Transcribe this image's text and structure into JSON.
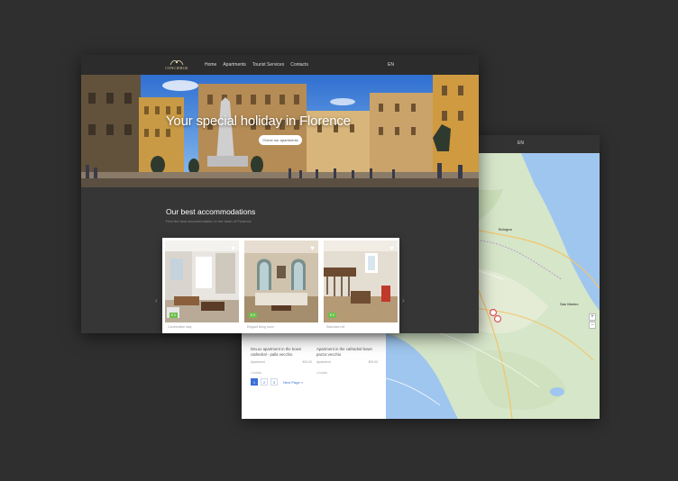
{
  "listing_window": {
    "lang": "EN",
    "cards": [
      {
        "title": "DeLux apartment in the bown cathedral - palla vecchio",
        "type": "Apartment",
        "price": "€00.00",
        "extra": "4 Adults"
      },
      {
        "title": "Apartment in the cathedral bown pazza vecchio",
        "type": "Apartment",
        "price": "€00.00",
        "extra": "4 Adults"
      }
    ],
    "pagination": {
      "pages": [
        "1",
        "2",
        "3"
      ],
      "next_label": "Next Page »"
    },
    "map": {
      "labels": {
        "city_a": "Bologna",
        "city_b": "San Marino"
      },
      "zoom_in": "+",
      "zoom_out": "−"
    }
  },
  "site": {
    "logo_text": "CONCIERGE",
    "nav": [
      "Home",
      "Apartments",
      "Tourist Services",
      "Contacts"
    ],
    "lang": "EN",
    "hero_title": "Your special holiday in Florence",
    "hero_button": "Check our apartments",
    "section_title": "Our best accommodations",
    "section_subtitle": "Find the best accommodation in the heart of Florence",
    "prev_arrow": "‹",
    "next_arrow": "›",
    "cards": [
      {
        "badge": "€ 0",
        "caption": "Comfortable stay",
        "heart": "♥"
      },
      {
        "badge": "€ 0",
        "caption": "Elegant living room",
        "heart": "♥"
      },
      {
        "badge": "€ 0",
        "caption": "Staircase loft",
        "heart": "♥"
      }
    ]
  },
  "colors": {
    "background": "#2f2f2f",
    "accent_blue": "#3a6fd8",
    "badge_green": "#6cbf4a",
    "nav_dark": "#2c2c2c"
  }
}
